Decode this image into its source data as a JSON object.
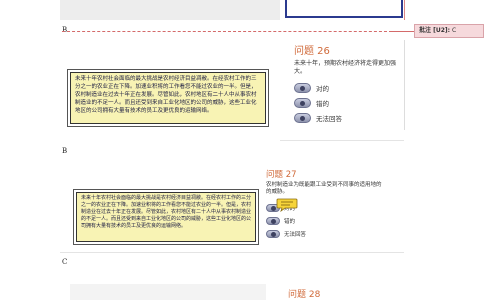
{
  "comment": {
    "label": "批注 [U2]:",
    "value": "C"
  },
  "section_markers": [
    "B",
    "B",
    "C"
  ],
  "passage": "未来十年农村社会面临的最大挑战是农村经济目益凋敝。在经农村工作的三分之一的农业正在下降。加速业积将的工作看您不能过农业的一半。但是，农村制造业在过去十年正在发展。尽管如此，农村地区有二十人中从事农村制造业的不足一人。而且还受到来自工业化地区的公司的威胁，这些工业化地区的公司拥有大量有技术的员工及更优良的运输网络。",
  "questions": [
    {
      "title": "问题 26",
      "text": "未来十年，预期农村经济将走得更加强大。",
      "options": [
        "对的",
        "错的",
        "无法回答"
      ]
    },
    {
      "title": "问题 27",
      "text": "农村制造业为既能跟工业受到不同事的适用地的的威胁。",
      "options": [
        "对的",
        "错的",
        "无法回答"
      ]
    },
    {
      "title": "问题 28"
    }
  ]
}
